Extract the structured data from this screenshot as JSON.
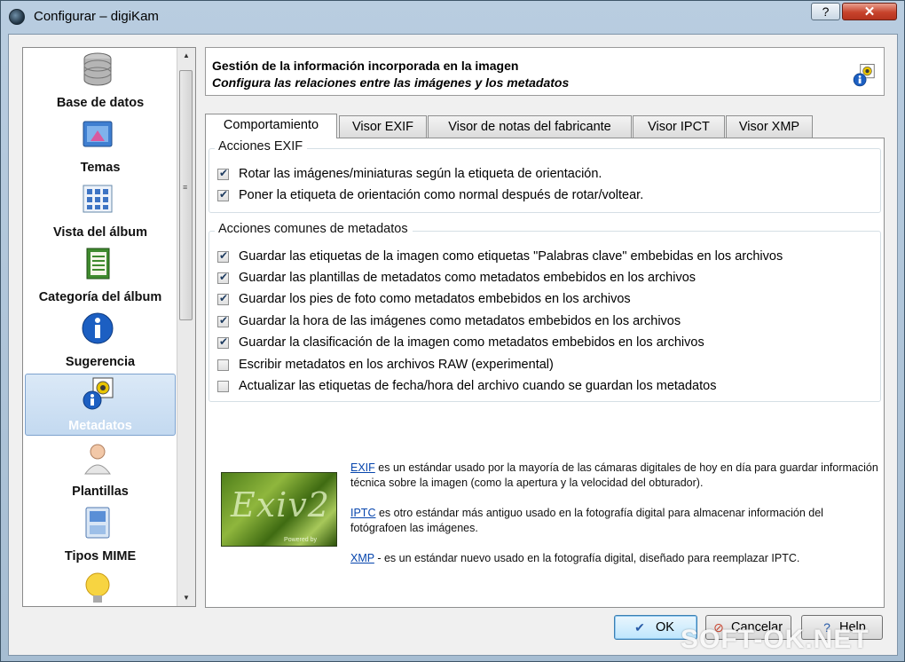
{
  "window": {
    "title": "Configurar – digiKam",
    "help_label": "?",
    "close_label": "✕"
  },
  "sidebar": {
    "items": [
      {
        "label": "Base de datos",
        "icon": "database-icon"
      },
      {
        "label": "Temas",
        "icon": "themes-icon"
      },
      {
        "label": "Vista del álbum",
        "icon": "album-view-icon"
      },
      {
        "label": "Categoría del álbum",
        "icon": "album-category-icon"
      },
      {
        "label": "Sugerencia",
        "icon": "info-icon"
      },
      {
        "label": "Metadatos",
        "icon": "metadata-icon",
        "selected": true
      },
      {
        "label": "Plantillas",
        "icon": "templates-icon"
      },
      {
        "label": "Tipos MIME",
        "icon": "mime-types-icon"
      },
      {
        "label": "",
        "icon": "lightbulb-icon"
      }
    ]
  },
  "header": {
    "title": "Gestión de la información incorporada en la imagen",
    "subtitle": "Configura las relaciones entre las imágenes y los metadatos"
  },
  "tabs": [
    {
      "label": "Comportamiento",
      "active": true
    },
    {
      "label": "Visor EXIF"
    },
    {
      "label": "Visor de notas del fabricante"
    },
    {
      "label": "Visor IPCT"
    },
    {
      "label": "Visor XMP"
    }
  ],
  "exif_group": {
    "title": "Acciones EXIF",
    "options": [
      {
        "label": "Rotar las imágenes/miniaturas según la etiqueta de orientación.",
        "checked": true
      },
      {
        "label": "Poner la etiqueta de orientación como normal después de rotar/voltear.",
        "checked": true
      }
    ]
  },
  "metadata_group": {
    "title": "Acciones comunes de metadatos",
    "options": [
      {
        "label": "Guardar las etiquetas de la imagen como etiquetas \"Palabras clave\" embebidas en los archivos",
        "checked": true
      },
      {
        "label": "Guardar las plantillas de metadatos como metadatos embebidos en los archivos",
        "checked": true
      },
      {
        "label": "Guardar los pies de foto como metadatos embebidos en los archivos",
        "checked": true
      },
      {
        "label": "Guardar la hora de las imágenes como metadatos embebidos en los archivos",
        "checked": true
      },
      {
        "label": "Guardar la clasificación de la imagen como metadatos embebidos en los archivos",
        "checked": true
      },
      {
        "label": "Escribir metadatos en los archivos RAW (experimental)",
        "checked": false
      },
      {
        "label": "Actualizar las etiquetas de fecha/hora del archivo cuando se guardan los metadatos",
        "checked": false
      }
    ]
  },
  "logo": {
    "text": "Exiv2",
    "powered": "Powered by"
  },
  "info": [
    {
      "link": "EXIF",
      "text": " es un estándar usado por la mayoría de las cámaras digitales de hoy en día para guardar información técnica sobre la imagen (como la apertura y la velocidad del obturador)."
    },
    {
      "link": "IPTC",
      "text": " es otro estándar más antiguo usado en la fotografía digital para almacenar información del fotógrafoen las imágenes."
    },
    {
      "link": "XMP",
      "text": " - es un estándar nuevo usado en la fotografía digital, diseñado para reemplazar IPTC."
    }
  ],
  "buttons": {
    "ok": "OK",
    "cancel": "Cancelar",
    "help": "Help"
  },
  "watermark": "SOFT-OK.NET",
  "colors": {
    "selection": "#c3d9f0",
    "link": "#0645ad",
    "close_button": "#c7432c"
  }
}
